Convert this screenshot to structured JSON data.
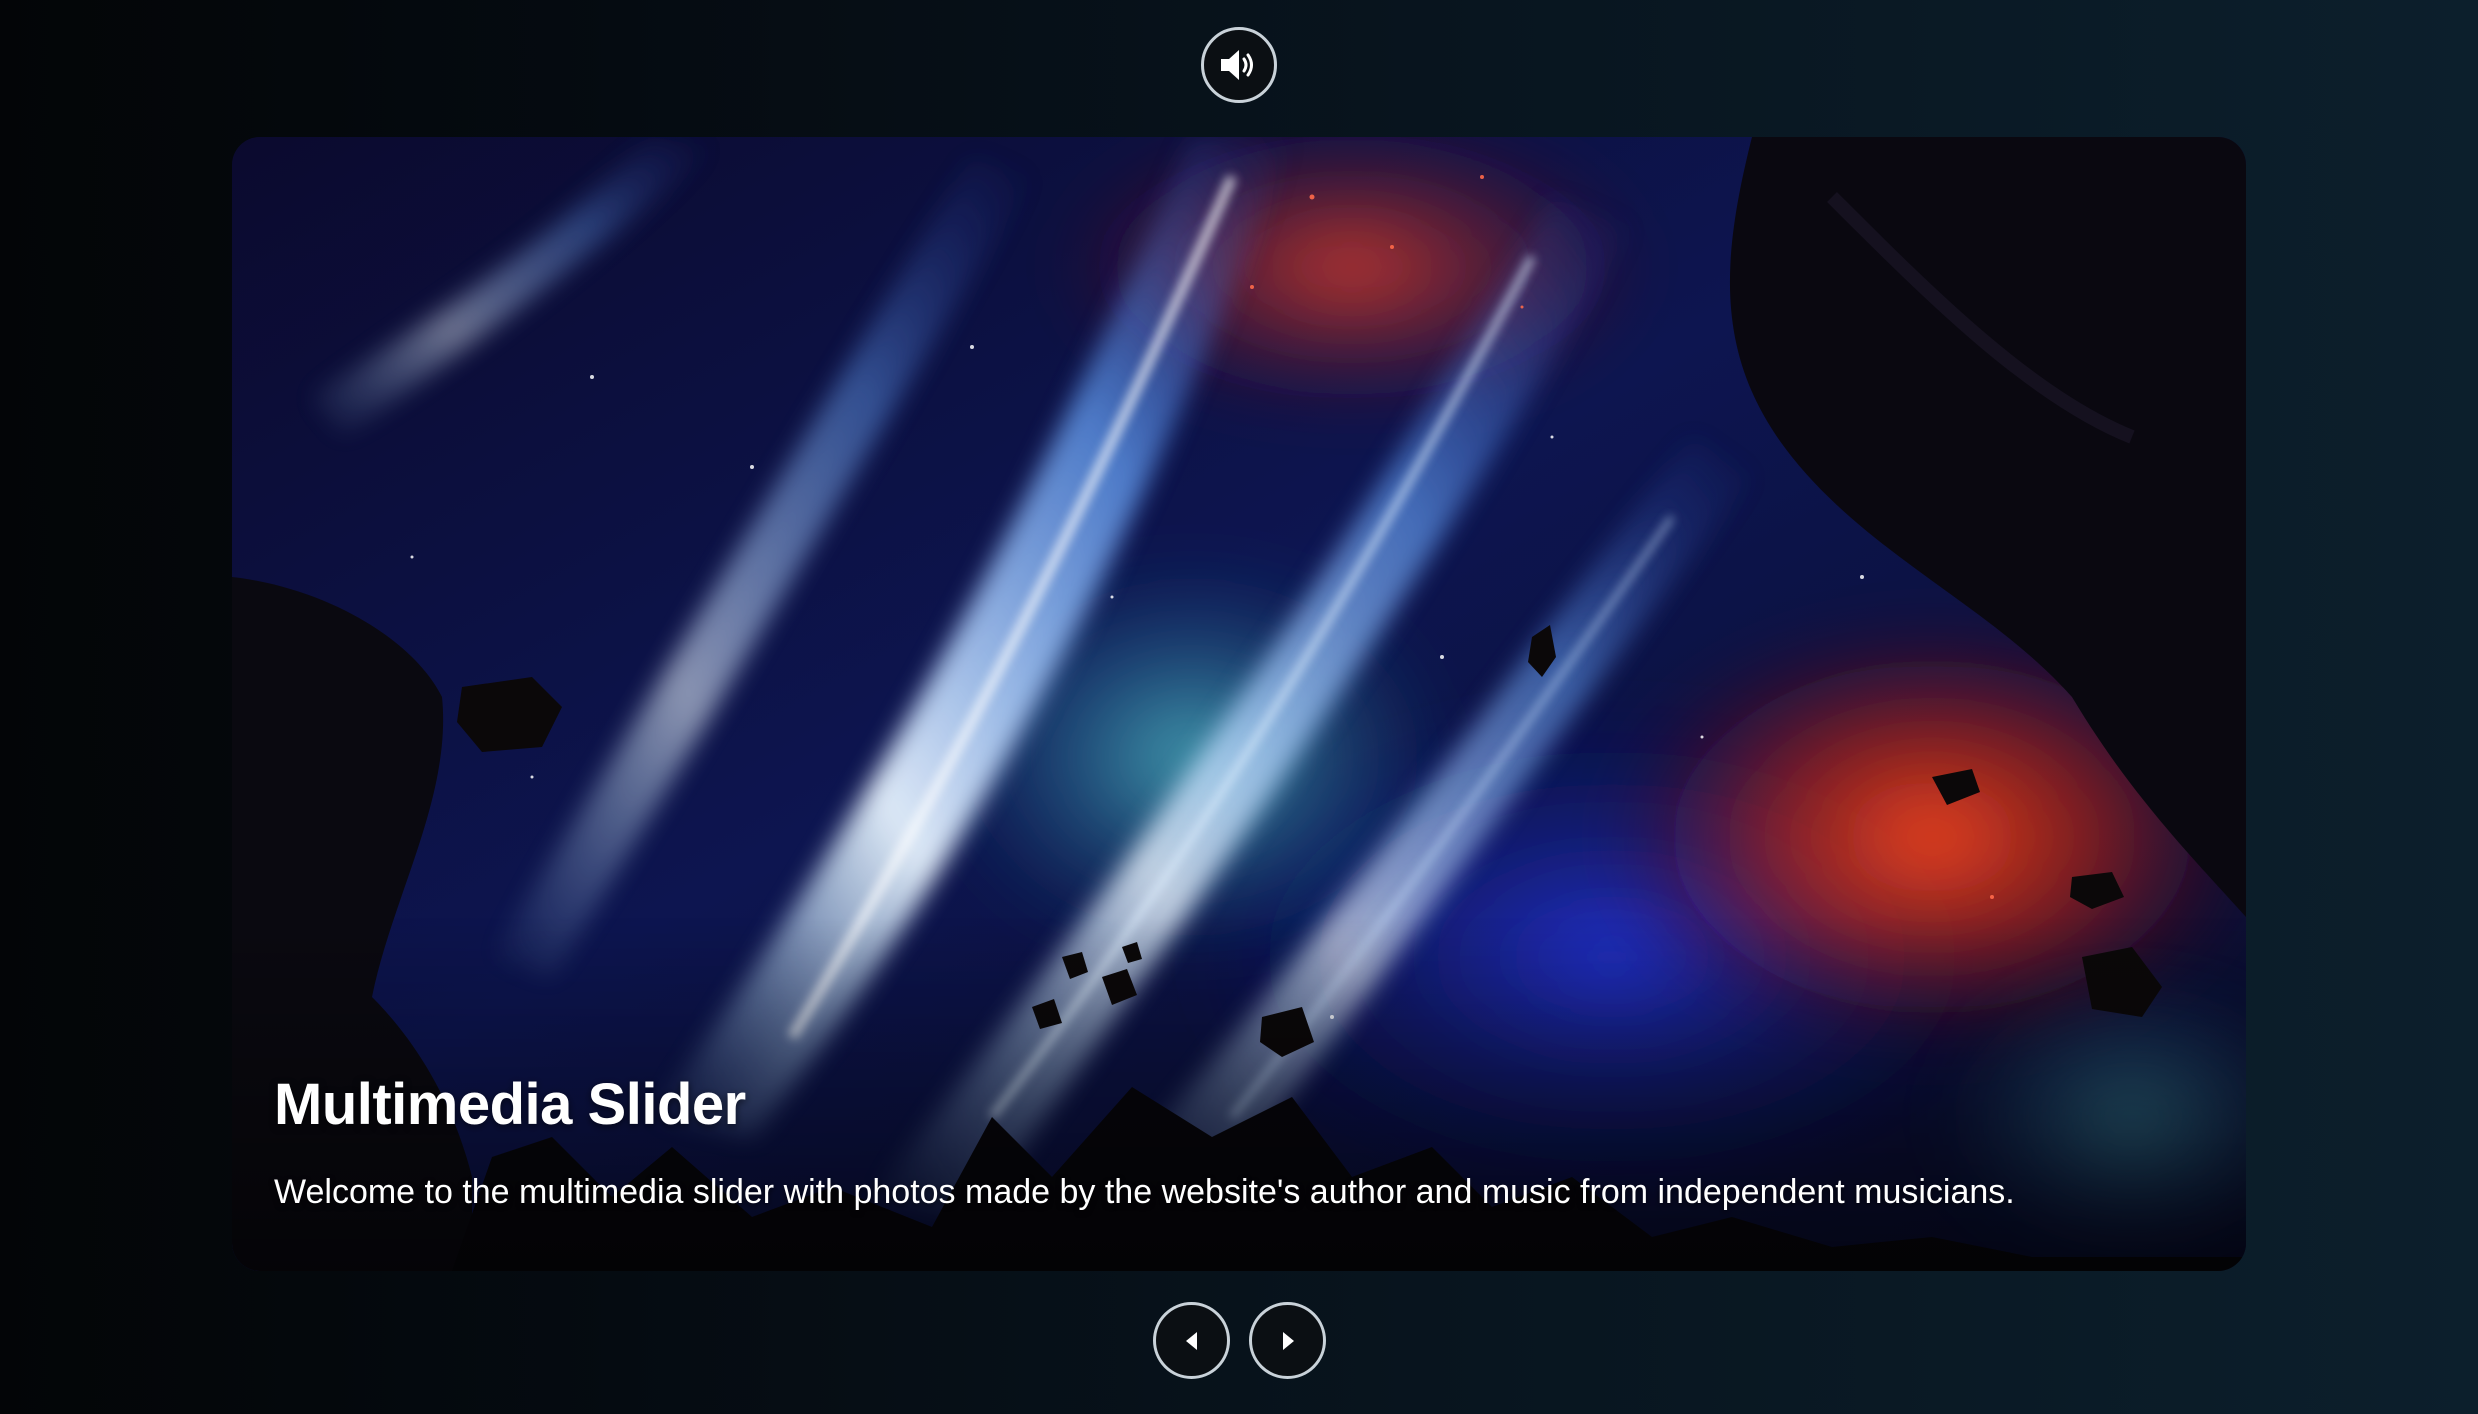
{
  "controls": {
    "sound": {
      "icon": "speaker-volume-icon"
    },
    "prev": {
      "icon": "caret-left-icon"
    },
    "next": {
      "icon": "caret-right-icon"
    }
  },
  "slide": {
    "title": "Multimedia Slider",
    "description": "Welcome to the multimedia slider with photos made by the website's author and music from independent musicians."
  }
}
